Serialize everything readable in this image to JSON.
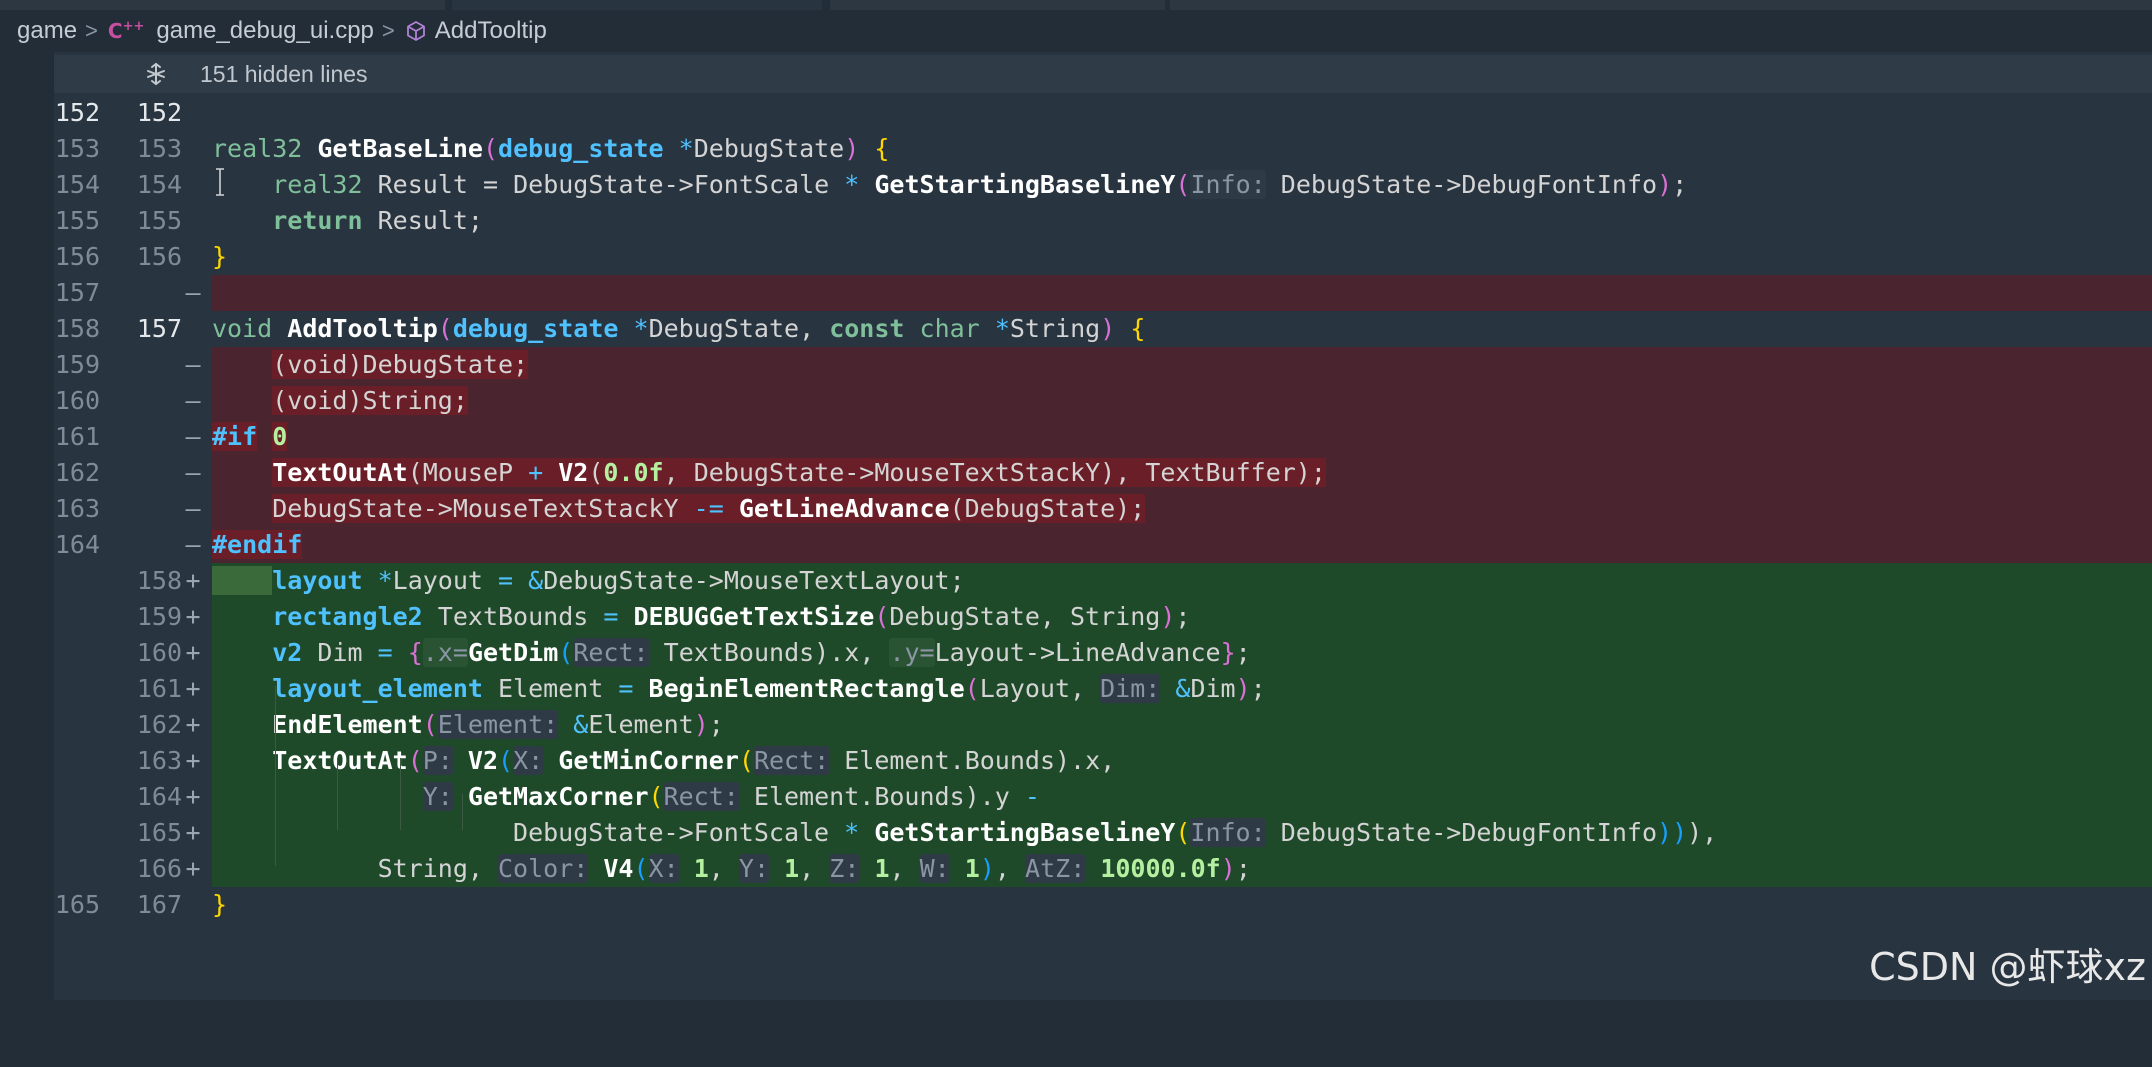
{
  "breadcrumb": {
    "folder": "game",
    "file": "game_debug_ui.cpp",
    "symbol": "AddTooltip",
    "file_icon": "cpp-file-icon",
    "symbol_icon": "cube-symbol-icon"
  },
  "hidden": {
    "label": "151 hidden lines",
    "icon": "unfold-icon"
  },
  "colors": {
    "deleted_bg": "#4a2530",
    "added_bg": "#1f4a2a",
    "editor_bg": "#283440"
  },
  "lines": [
    {
      "old": "152",
      "new": "152",
      "mark": ""
    },
    {
      "old": "153",
      "new": "153",
      "mark": ""
    },
    {
      "old": "154",
      "new": "154",
      "mark": ""
    },
    {
      "old": "155",
      "new": "155",
      "mark": ""
    },
    {
      "old": "156",
      "new": "156",
      "mark": ""
    },
    {
      "old": "157",
      "new": "",
      "mark": "—"
    },
    {
      "old": "158",
      "new": "157",
      "mark": ""
    },
    {
      "old": "159",
      "new": "",
      "mark": "—"
    },
    {
      "old": "160",
      "new": "",
      "mark": "—"
    },
    {
      "old": "161",
      "new": "",
      "mark": "—"
    },
    {
      "old": "162",
      "new": "",
      "mark": "—"
    },
    {
      "old": "163",
      "new": "",
      "mark": "—"
    },
    {
      "old": "164",
      "new": "",
      "mark": "—"
    },
    {
      "old": "",
      "new": "158",
      "mark": "+"
    },
    {
      "old": "",
      "new": "159",
      "mark": "+"
    },
    {
      "old": "",
      "new": "160",
      "mark": "+"
    },
    {
      "old": "",
      "new": "161",
      "mark": "+"
    },
    {
      "old": "",
      "new": "162",
      "mark": "+"
    },
    {
      "old": "",
      "new": "163",
      "mark": "+"
    },
    {
      "old": "",
      "new": "164",
      "mark": "+"
    },
    {
      "old": "",
      "new": "165",
      "mark": "+"
    },
    {
      "old": "",
      "new": "166",
      "mark": "+"
    },
    {
      "old": "165",
      "new": "167",
      "mark": ""
    }
  ],
  "code": {
    "l153": [
      "real32",
      "GetBaseLine",
      "(",
      "debug_state",
      "*",
      "DebugState",
      ")",
      "{"
    ],
    "l154": [
      "real32",
      "Result",
      "=",
      "DebugState->FontScale",
      "*",
      "GetStartingBaselineY",
      "(",
      "Info:",
      "DebugState->DebugFontInfo",
      ")",
      ";"
    ],
    "l155": [
      "return",
      "Result;"
    ],
    "l156": [
      "}"
    ],
    "l158": [
      "void",
      "AddTooltip",
      "(",
      "debug_state",
      "*",
      "DebugState,",
      "const",
      "char",
      "*",
      "String",
      ")",
      "{"
    ],
    "l159": [
      "(void)DebugState;"
    ],
    "l160": [
      "(void)String;"
    ],
    "l161": [
      "#if",
      "0"
    ],
    "l162": [
      "TextOutAt",
      "(MouseP",
      "+",
      "V2",
      "(",
      "0.0f",
      ", DebugState->MouseTextStackY",
      ")",
      ", TextBuffer);"
    ],
    "l163": [
      "DebugState->MouseTextStackY",
      "-=",
      "GetLineAdvance",
      "(DebugState);"
    ],
    "l164": [
      "#endif"
    ],
    "a158": [
      "layout",
      "*",
      "Layout",
      "=",
      "&",
      "DebugState->MouseTextLayout;"
    ],
    "a159": [
      "rectangle2",
      "TextBounds",
      "=",
      "DEBUGGetTextSize",
      "(",
      "DebugState, String",
      ")",
      ";"
    ],
    "a160": [
      "v2",
      "Dim",
      "=",
      "{",
      ".x=",
      "GetDim",
      "(",
      "Rect:",
      "TextBounds",
      ").x,",
      ".y=",
      "Layout->LineAdvance",
      "}",
      ";"
    ],
    "a161": [
      "layout_element",
      "Element",
      "=",
      "BeginElementRectangle",
      "(",
      "Layout,",
      "Dim:",
      "&",
      "Dim",
      ")",
      ";"
    ],
    "a162": [
      "EndElement",
      "(",
      "Element:",
      "&",
      "Element",
      ")",
      ";"
    ],
    "a163": [
      "TextOutAt",
      "(",
      "P:",
      "V2",
      "(",
      "X:",
      "GetMinCorner",
      "(",
      "Rect:",
      "Element.Bounds",
      ").x,"
    ],
    "a164": [
      "Y:",
      "GetMaxCorner",
      "(",
      "Rect:",
      "Element.Bounds",
      ").y",
      "-"
    ],
    "a165": [
      "DebugState->FontScale",
      "*",
      "GetStartingBaselineY",
      "(",
      "Info:",
      "DebugState->DebugFontInfo",
      "))",
      "),"
    ],
    "a166": [
      "String,",
      "Color:",
      "V4",
      "(",
      "X:",
      "1",
      ",",
      "Y:",
      "1",
      ",",
      "Z:",
      "1",
      ",",
      "W:",
      "1",
      ")",
      ",",
      "AtZ:",
      "10000.0f",
      ")",
      ";"
    ],
    "l165": [
      "}"
    ]
  },
  "watermark": "CSDN @虾球xz"
}
